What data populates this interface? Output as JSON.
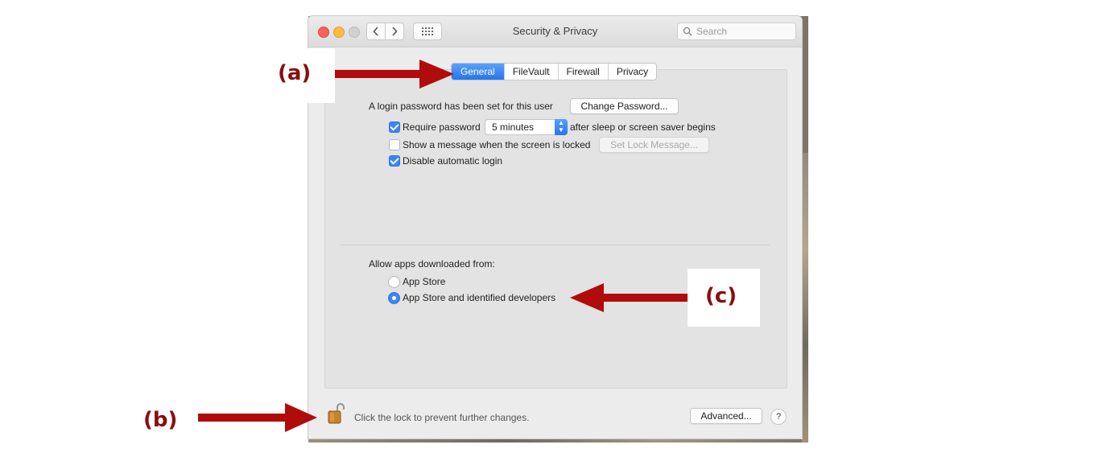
{
  "window": {
    "title": "Security & Privacy",
    "search_placeholder": "Search"
  },
  "tabs": [
    {
      "label": "General",
      "active": true
    },
    {
      "label": "FileVault",
      "active": false
    },
    {
      "label": "Firewall",
      "active": false
    },
    {
      "label": "Privacy",
      "active": false
    }
  ],
  "general": {
    "login_text": "A login password has been set for this user",
    "change_password_button": "Change Password...",
    "require_password_label": "Require password",
    "require_password_checked": true,
    "require_password_delay": "5 minutes",
    "after_sleep_text": "after sleep or screen saver begins",
    "show_message_label": "Show a message when the screen is locked",
    "show_message_checked": false,
    "set_lock_message_button": "Set Lock Message...",
    "disable_auto_login_label": "Disable automatic login",
    "disable_auto_login_checked": true
  },
  "allow_apps": {
    "heading": "Allow apps downloaded from:",
    "options": [
      {
        "label": "App Store",
        "selected": false
      },
      {
        "label": "App Store and identified developers",
        "selected": true
      }
    ]
  },
  "footer": {
    "lock_text": "Click the lock to prevent further changes.",
    "advanced_button": "Advanced...",
    "help_button": "?"
  },
  "annotations": {
    "a": "(a)",
    "b": "(b)",
    "c": "(c)",
    "color": "#8b0e0e"
  },
  "icons": [
    "close-icon",
    "minimize-icon",
    "zoom-icon",
    "back-chevron-icon",
    "forward-chevron-icon",
    "show-all-grid-icon",
    "search-icon",
    "popup-arrows-icon",
    "unlocked-padlock-icon",
    "help-icon",
    "annotation-arrow-icon"
  ]
}
